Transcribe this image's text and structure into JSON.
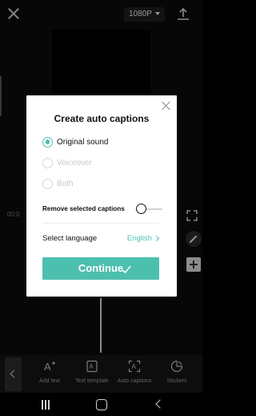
{
  "topbar": {
    "resolution": "1080P"
  },
  "editor": {
    "timecode": "00:0"
  },
  "dialog": {
    "title": "Create auto captions",
    "options": [
      {
        "label": "Original sound",
        "selected": true,
        "enabled": true
      },
      {
        "label": "Voiceover",
        "selected": false,
        "enabled": false
      },
      {
        "label": "Both",
        "selected": false,
        "enabled": false
      }
    ],
    "remove_label": "Remove selected captions",
    "remove_toggle_on": false,
    "language_label": "Select language",
    "language_value": "English",
    "continue_label": "Continue"
  },
  "toolbar": {
    "items": [
      {
        "label": "Add text",
        "icon": "add-text-icon"
      },
      {
        "label": "Text template",
        "icon": "text-template-icon"
      },
      {
        "label": "Auto captions",
        "icon": "auto-captions-icon"
      },
      {
        "label": "Stickers",
        "icon": "stickers-icon"
      }
    ]
  },
  "colors": {
    "accent": "#4dbfae",
    "background": "#0b0b0b",
    "dialog": "#ffffff"
  }
}
